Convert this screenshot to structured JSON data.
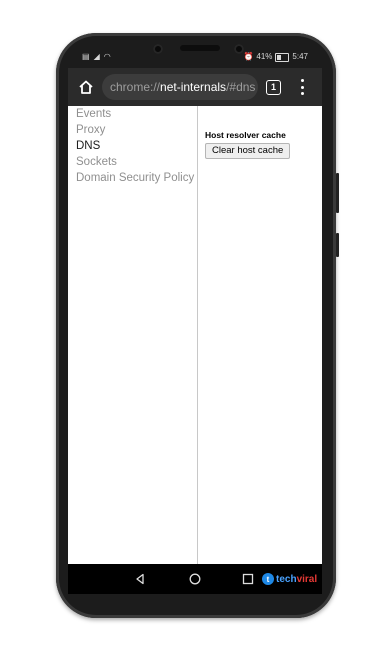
{
  "status_bar": {
    "battery": "41%",
    "time": "5:47",
    "left_icons": [
      "sim-icon",
      "signal-icon",
      "wifi-icon"
    ],
    "right_icons": [
      "alarm-icon",
      "battery-icon"
    ]
  },
  "browser": {
    "url_scheme": "chrome://",
    "url_host": "net-internals",
    "url_fragment": "/#dns",
    "tab_count": "1"
  },
  "sidebar": {
    "items": [
      {
        "label": "Events",
        "active": false
      },
      {
        "label": "Proxy",
        "active": false
      },
      {
        "label": "DNS",
        "active": true
      },
      {
        "label": "Sockets",
        "active": false
      },
      {
        "label": "Domain Security Policy",
        "active": false
      }
    ]
  },
  "dns_panel": {
    "section_title": "Host resolver cache",
    "clear_button_label": "Clear host cache"
  },
  "watermark": {
    "logo_letter": "t",
    "brand_part1": "tech",
    "brand_part2": "viral"
  },
  "colors": {
    "toolbar_bg": "#2b2b2b",
    "urlbar_bg": "#3c3c3c",
    "nav_inactive": "#8f8f8f",
    "nav_active": "#202020"
  }
}
